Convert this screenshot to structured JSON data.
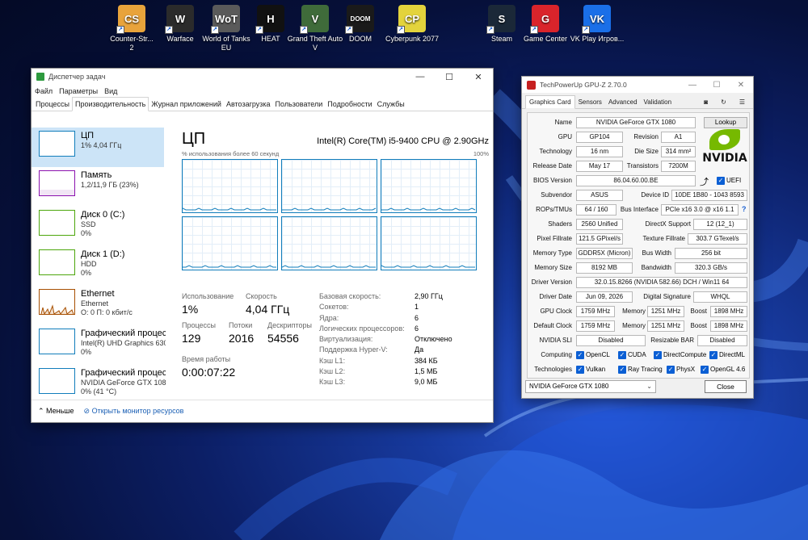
{
  "desktop": {
    "icons": [
      {
        "label": "Counter-Str...\n2",
        "glyph": "CS",
        "color": "#e8a33b"
      },
      {
        "label": "Warface",
        "glyph": "W",
        "color": "#2b2b2b"
      },
      {
        "label": "World of Tanks EU",
        "glyph": "WoT",
        "color": "#5a5a5a"
      },
      {
        "label": "HEAT",
        "glyph": "H",
        "color": "#111111"
      },
      {
        "label": "Grand Theft Auto V",
        "glyph": "V",
        "color": "#3f6b3a"
      },
      {
        "label": "DOOM",
        "glyph": "DOOM",
        "color": "#1a1a1a"
      },
      {
        "label": "Cyberpunk 2077",
        "glyph": "CP",
        "color": "#e3d33c"
      },
      {
        "label": "Steam",
        "glyph": "S",
        "color": "#1b2838"
      },
      {
        "label": "Game Center",
        "glyph": "G",
        "color": "#d9242b"
      },
      {
        "label": "VK Play Игров...",
        "glyph": "VK",
        "color": "#1a6fe8"
      }
    ]
  },
  "taskmanager": {
    "title": "Диспетчер задач",
    "menu": [
      "Файл",
      "Параметры",
      "Вид"
    ],
    "tabs": [
      "Процессы",
      "Производительность",
      "Журнал приложений",
      "Автозагрузка",
      "Пользователи",
      "Подробности",
      "Службы"
    ],
    "active_tab": 1,
    "side": [
      {
        "name": "ЦП",
        "l2": "1% 4,04 ГГц",
        "l3": "",
        "color": "#117dbb"
      },
      {
        "name": "Память",
        "l2": "1,2/11,9 ГБ (23%)",
        "l3": "",
        "color": "#8b12ae"
      },
      {
        "name": "Диск 0 (C:)",
        "l2": "SSD",
        "l3": "0%",
        "color": "#4da60c"
      },
      {
        "name": "Диск 1 (D:)",
        "l2": "HDD",
        "l3": "0%",
        "color": "#4da60c"
      },
      {
        "name": "Ethernet",
        "l2": "Ethernet",
        "l3": "О: 0 П: 0 кбит/с",
        "color": "#a74f01"
      },
      {
        "name": "Графический процессор 0",
        "l2": "Intel(R) UHD Graphics 630",
        "l3": "0%",
        "color": "#117dbb"
      },
      {
        "name": "Графический процессор 1",
        "l2": "NVIDIA GeForce GTX 1080",
        "l3": "0% (41 °C)",
        "color": "#117dbb"
      }
    ],
    "cpu": {
      "title": "ЦП",
      "model": "Intel(R) Core(TM) i5-9400 CPU @ 2.90GHz",
      "graph_label": "% использования более 60 секунд",
      "graph_max": "100%",
      "usage_label": "Использование",
      "usage": "1%",
      "speed_label": "Скорость",
      "speed": "4,04 ГГц",
      "proc_label": "Процессы",
      "proc": "129",
      "threads_label": "Потоки",
      "threads": "2016",
      "handles_label": "Дескрипторы",
      "handles": "54556",
      "uptime_label": "Время работы",
      "uptime": "0:00:07:22",
      "details": [
        {
          "k": "Базовая скорость:",
          "v": "2,90 ГГц"
        },
        {
          "k": "Сокетов:",
          "v": "1"
        },
        {
          "k": "Ядра:",
          "v": "6"
        },
        {
          "k": "Логических процессоров:",
          "v": "6"
        },
        {
          "k": "Виртуализация:",
          "v": "Отключено"
        },
        {
          "k": "Поддержка Hyper-V:",
          "v": "Да"
        },
        {
          "k": "Кэш L1:",
          "v": "384 КБ"
        },
        {
          "k": "Кэш L2:",
          "v": "1,5 МБ"
        },
        {
          "k": "Кэш L3:",
          "v": "9,0 МБ"
        }
      ]
    },
    "footer": {
      "less": "Меньше",
      "monitor": "Открыть монитор ресурсов"
    }
  },
  "gpuz": {
    "title": "TechPowerUp GPU-Z 2.70.0",
    "tabs": [
      "Graphics Card",
      "Sensors",
      "Advanced",
      "Validation"
    ],
    "name_label": "Name",
    "name": "NVIDIA GeForce GTX 1080",
    "lookup": "Lookup",
    "gpu_label": "GPU",
    "gpu": "GP104",
    "revision_label": "Revision",
    "revision": "A1",
    "tech_label": "Technology",
    "tech": "16 nm",
    "die_label": "Die Size",
    "die": "314 mm²",
    "release_label": "Release Date",
    "release": "May 17",
    "trans_label": "Transistors",
    "trans": "7200M",
    "bios_label": "BIOS Version",
    "bios": "86.04.60.00.BE",
    "uefi": "UEFI",
    "subvendor_label": "Subvendor",
    "subvendor": "ASUS",
    "devid_label": "Device ID",
    "devid": "10DE 1B80 - 1043 8593",
    "rops_label": "ROPs/TMUs",
    "rops": "64 / 160",
    "bus_label": "Bus Interface",
    "bus": "PCIe x16 3.0 @ x16 1.1",
    "help": "?",
    "shaders_label": "Shaders",
    "shaders": "2560 Unified",
    "dx_label": "DirectX Support",
    "dx": "12 (12_1)",
    "pixel_label": "Pixel Fillrate",
    "pixel": "121.5 GPixel/s",
    "texture_label": "Texture Fillrate",
    "texture": "303.7 GTexel/s",
    "memtype_label": "Memory Type",
    "memtype": "GDDR5X (Micron)",
    "buswidth_label": "Bus Width",
    "buswidth": "256 bit",
    "memsize_label": "Memory Size",
    "memsize": "8192 MB",
    "bandwidth_label": "Bandwidth",
    "bandwidth": "320.3 GB/s",
    "driver_label": "Driver Version",
    "driver": "32.0.15.8266 (NVIDIA 582.66) DCH / Win11 64",
    "drvdate_label": "Driver Date",
    "drvdate": "Jun 09, 2026",
    "sig_label": "Digital Signature",
    "sig": "WHQL",
    "gpuclock_label": "GPU Clock",
    "gpuclock": "1759 MHz",
    "mem_label": "Memory",
    "memclock": "1251 MHz",
    "boost_label": "Boost",
    "boost": "1898 MHz",
    "defclock_label": "Default Clock",
    "defclock": "1759 MHz",
    "defmem": "1251 MHz",
    "defboost": "1898 MHz",
    "sli_label": "NVIDIA SLI",
    "sli": "Disabled",
    "rbar_label": "Resizable BAR",
    "rbar": "Disabled",
    "computing_label": "Computing",
    "computing": [
      "OpenCL",
      "CUDA",
      "DirectCompute",
      "DirectML"
    ],
    "tech2_label": "Technologies",
    "technologies": [
      "Vulkan",
      "Ray Tracing",
      "PhysX",
      "OpenGL 4.6"
    ],
    "logo_text": "NVIDIA",
    "select": "NVIDIA GeForce GTX 1080",
    "close": "Close"
  }
}
